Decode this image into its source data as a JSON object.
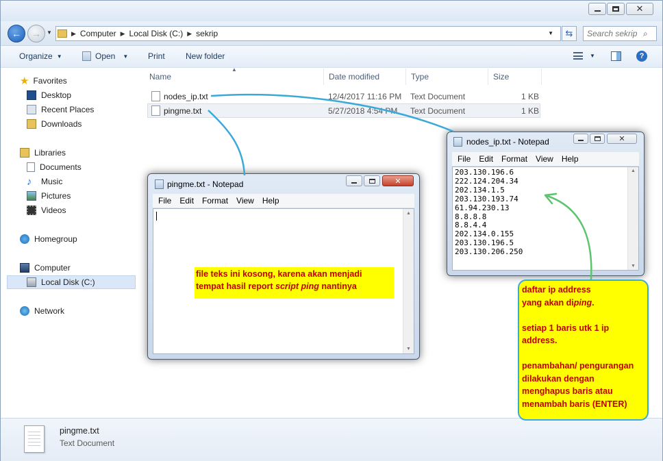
{
  "window": {
    "breadcrumb": [
      "Computer",
      "Local Disk (C:)",
      "sekrip"
    ],
    "search_placeholder": "Search sekrip"
  },
  "toolbar": {
    "organize": "Organize",
    "open": "Open",
    "print": "Print",
    "new_folder": "New folder"
  },
  "sidebar": {
    "favorites": "Favorites",
    "desktop": "Desktop",
    "recent_places": "Recent Places",
    "downloads": "Downloads",
    "libraries": "Libraries",
    "documents": "Documents",
    "music": "Music",
    "pictures": "Pictures",
    "videos": "Videos",
    "homegroup": "Homegroup",
    "computer": "Computer",
    "local_disk": "Local Disk (C:)",
    "network": "Network"
  },
  "columns": {
    "name": "Name",
    "date_modified": "Date modified",
    "type": "Type",
    "size": "Size"
  },
  "files": [
    {
      "name": "nodes_ip.txt",
      "date": "12/4/2017 11:16 PM",
      "type": "Text Document",
      "size": "1 KB"
    },
    {
      "name": "pingme.txt",
      "date": "5/27/2018 4:54 PM",
      "type": "Text Document",
      "size": "1 KB"
    }
  ],
  "details": {
    "file_name": "pingme.txt",
    "file_type": "Text Document"
  },
  "notepad_menu": {
    "file": "File",
    "edit": "Edit",
    "format": "Format",
    "view": "View",
    "help": "Help"
  },
  "notepad_pingme": {
    "title": "pingme.txt - Notepad"
  },
  "notepad_nodes": {
    "title": "nodes_ip.txt - Notepad",
    "lines": [
      "203.130.196.6",
      "222.124.204.34",
      "202.134.1.5",
      "203.130.193.74",
      "61.94.230.13",
      "8.8.8.8",
      "8.8.4.4",
      "202.134.0.155",
      "203.130.196.5",
      "203.130.206.250"
    ]
  },
  "annotations": {
    "empty_note": {
      "line1": "file teks ini kosong, karena akan menjadi",
      "line2a": "tempat hasil report ",
      "line2b": "script ping",
      "line2c": " nantinya"
    },
    "ip_note": {
      "l1": "daftar ip address",
      "l2a": "yang akan di",
      "l2b": "ping",
      "l2c": ".",
      "l3": "setiap 1 baris utk 1 ip",
      "l4": "address.",
      "l5": "penambahan/ pengurangan",
      "l6": "dilakukan dengan",
      "l7": "menghapus baris atau",
      "l8": "menambah baris (ENTER)"
    }
  },
  "colors": {
    "highlight": "#ffff00",
    "note_text": "#c00000",
    "arrow_blue": "#3aa9d8",
    "arrow_green": "#5cc36e"
  }
}
